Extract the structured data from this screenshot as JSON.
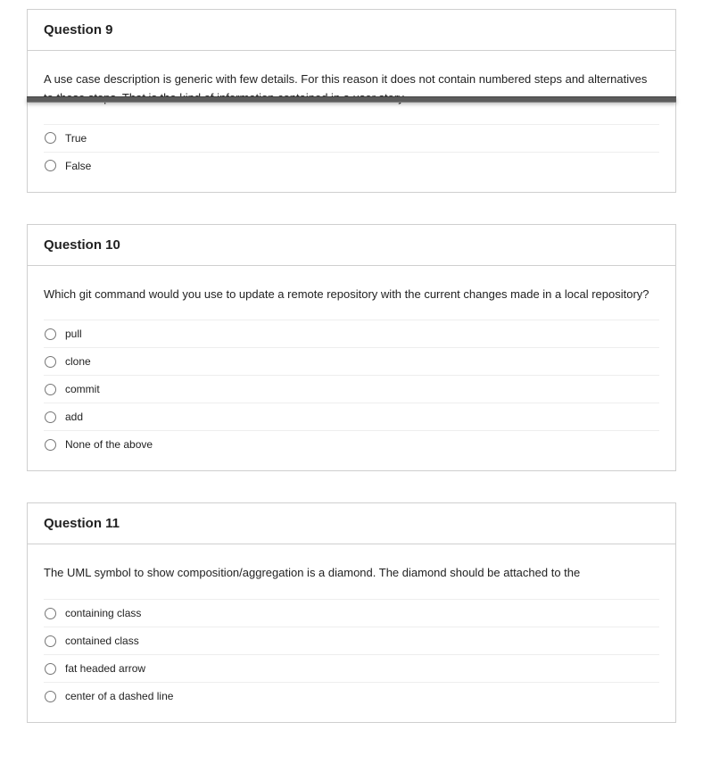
{
  "questions": [
    {
      "title": "Question 9",
      "text": "A use case description is generic with few details. For this reason it does not contain numbered steps and alternatives to those steps. That is the kind of information contained in a user story.",
      "options": [
        "True",
        "False"
      ],
      "showOverlay": true,
      "overlayTop": 98
    },
    {
      "title": "Question 10",
      "text": "Which git command would you use to update a remote repository with the current changes made in a local repository?",
      "options": [
        "pull",
        "clone",
        "commit",
        "add",
        "None of the above"
      ],
      "showOverlay": false
    },
    {
      "title": "Question 11",
      "text": "The UML symbol to show composition/aggregation is a diamond. The diamond should be attached to the",
      "options": [
        "containing class",
        "contained class",
        "fat headed arrow",
        "center of a dashed line"
      ],
      "showOverlay": false
    }
  ]
}
